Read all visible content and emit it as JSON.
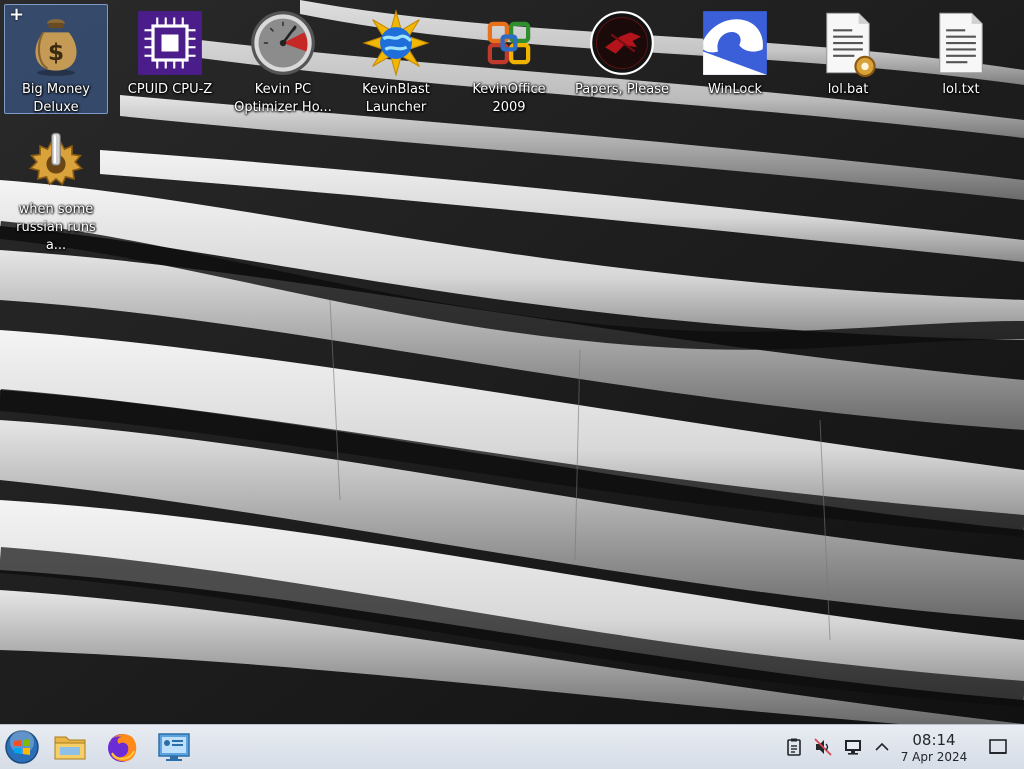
{
  "desktop": {
    "icons": [
      {
        "label": "Big Money Deluxe",
        "icon": "money-bag-icon",
        "selected": true
      },
      {
        "label": "CPUID CPU-Z",
        "icon": "cpu-chip-icon"
      },
      {
        "label": "Kevin PC Optimizer Ho...",
        "icon": "speedometer-icon"
      },
      {
        "label": "KevinBlast Launcher",
        "icon": "starburst-globe-icon"
      },
      {
        "label": "KevinOffice 2009",
        "icon": "office-logo-icon"
      },
      {
        "label": "Papers, Please",
        "icon": "papers-please-emblem-icon"
      },
      {
        "label": "WinLock",
        "icon": "winlock-icon"
      },
      {
        "label": "lol.bat",
        "icon": "batch-file-icon"
      },
      {
        "label": "lol.txt",
        "icon": "text-file-icon"
      },
      {
        "label": "when some russian runs a...",
        "icon": "gear-shortcut-icon"
      }
    ],
    "selection_badge": "+"
  },
  "taskbar": {
    "launchers": [
      {
        "icon": "start-menu-orb-icon"
      },
      {
        "icon": "file-manager-folder-icon"
      },
      {
        "icon": "firefox-icon"
      },
      {
        "icon": "system-settings-icon"
      }
    ],
    "tray": [
      {
        "icon": "clipboard-icon"
      },
      {
        "icon": "volume-muted-icon"
      },
      {
        "icon": "display-icon"
      },
      {
        "icon": "chevron-up-icon"
      }
    ],
    "clock": {
      "time": "08:14",
      "date": "7 Apr 2024"
    },
    "show_desktop_icon": "show-desktop-icon"
  },
  "colors": {
    "selection": "#3d5a8c",
    "taskbar": "#dfe4ec",
    "text": "#ffffff"
  }
}
